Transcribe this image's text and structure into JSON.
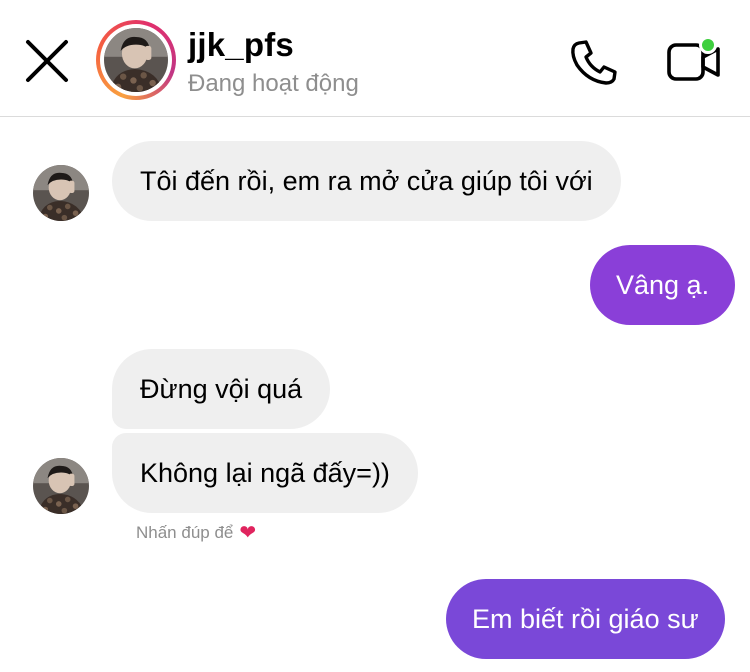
{
  "header": {
    "username": "jjk_pfs",
    "status": "Đang hoạt động",
    "icons": {
      "close": "close-icon",
      "call": "phone-icon",
      "video": "video-camera-icon"
    },
    "colors": {
      "online": "#3ecf3e",
      "divider": "#dbdbdb"
    }
  },
  "messages": [
    {
      "sender": "them",
      "text": "Tôi đến rồi, em ra mở cửa giúp tôi với"
    },
    {
      "sender": "me",
      "text": "Vâng ạ."
    },
    {
      "sender": "them",
      "text": "Đừng vội quá"
    },
    {
      "sender": "them",
      "text": "Không lại ngã đấy=))"
    },
    {
      "sender": "me",
      "text": "Em biết rồi giáo sư"
    }
  ],
  "hint": {
    "text": "Nhấn đúp để",
    "icon": "heart-icon"
  },
  "colors": {
    "incoming_bubble": "#efefef",
    "outgoing_bubble": "#8a3fd8",
    "muted_text": "#8e8e8e"
  }
}
